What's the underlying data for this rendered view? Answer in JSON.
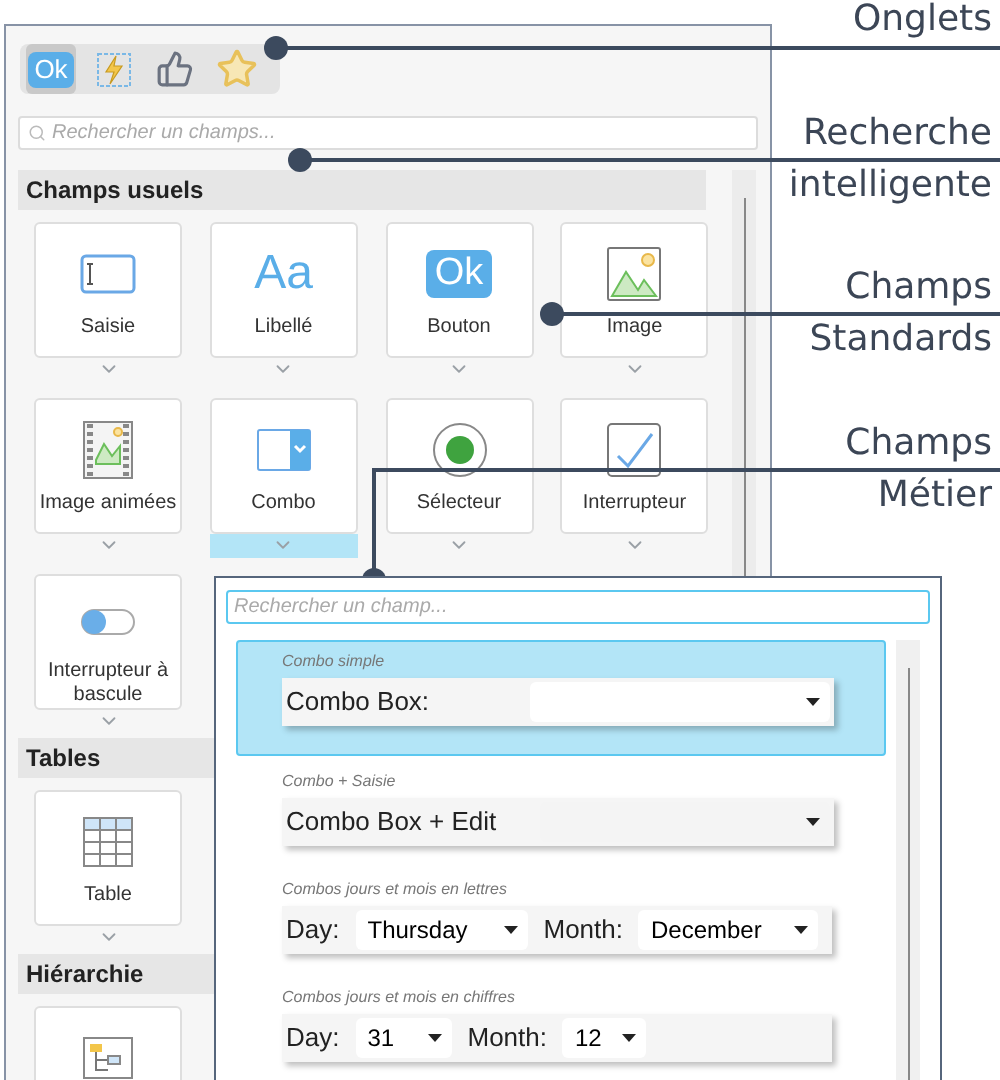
{
  "tabs": [
    {
      "kind": "ok",
      "label": "Ok",
      "selected": true
    },
    {
      "kind": "lightning",
      "selected": false
    },
    {
      "kind": "thumb",
      "selected": false
    },
    {
      "kind": "star",
      "selected": false
    }
  ],
  "search": {
    "placeholder": "Rechercher un champs..."
  },
  "sections": [
    {
      "title": "Champs usuels",
      "cards": [
        {
          "kind": "input",
          "label": "Saisie",
          "selected": false
        },
        {
          "kind": "text",
          "icon_text": "Aa",
          "label": "Libellé",
          "selected": false
        },
        {
          "kind": "button",
          "icon_text": "Ok",
          "label": "Bouton",
          "selected": false
        },
        {
          "kind": "image",
          "label": "Image",
          "selected": false
        },
        {
          "kind": "film",
          "label": "Image animées",
          "selected": false
        },
        {
          "kind": "combo",
          "label": "Combo",
          "selected": true
        },
        {
          "kind": "radio",
          "label": "Sélecteur",
          "selected": false
        },
        {
          "kind": "check",
          "label": "Interrupteur",
          "selected": false
        },
        {
          "kind": "toggle",
          "label": "Interrupteur à bascule",
          "selected": false
        }
      ]
    },
    {
      "title": "Tables",
      "cards": [
        {
          "kind": "table",
          "label": "Table",
          "selected": false
        }
      ]
    },
    {
      "title": "Hiérarchie",
      "cards": [
        {
          "kind": "tree"
        }
      ]
    }
  ],
  "popup": {
    "search": {
      "placeholder": "Rechercher un champ..."
    },
    "items": [
      {
        "kind": "combo",
        "caption": "Combo simple",
        "label": "Combo Box:",
        "selected": true
      },
      {
        "kind": "combo",
        "caption": "Combo + Saisie",
        "label": "Combo Box + Edit",
        "selected": false
      },
      {
        "kind": "day_month",
        "caption": "Combos jours et mois en lettres",
        "day_label": "Day:",
        "day": "Thursday",
        "month_label": "Month:",
        "month": "December",
        "selected": false
      },
      {
        "kind": "day_month",
        "caption": "Combos jours et mois en chiffres",
        "day_label": "Day:",
        "day": "31",
        "month_label": "Month:",
        "month": "12",
        "selected": false
      }
    ]
  },
  "callouts": [
    {
      "text": "Onglets"
    },
    {
      "text": "Recherche intelligente"
    },
    {
      "text": "Champs Standards"
    },
    {
      "text": "Champs Métier"
    }
  ]
}
